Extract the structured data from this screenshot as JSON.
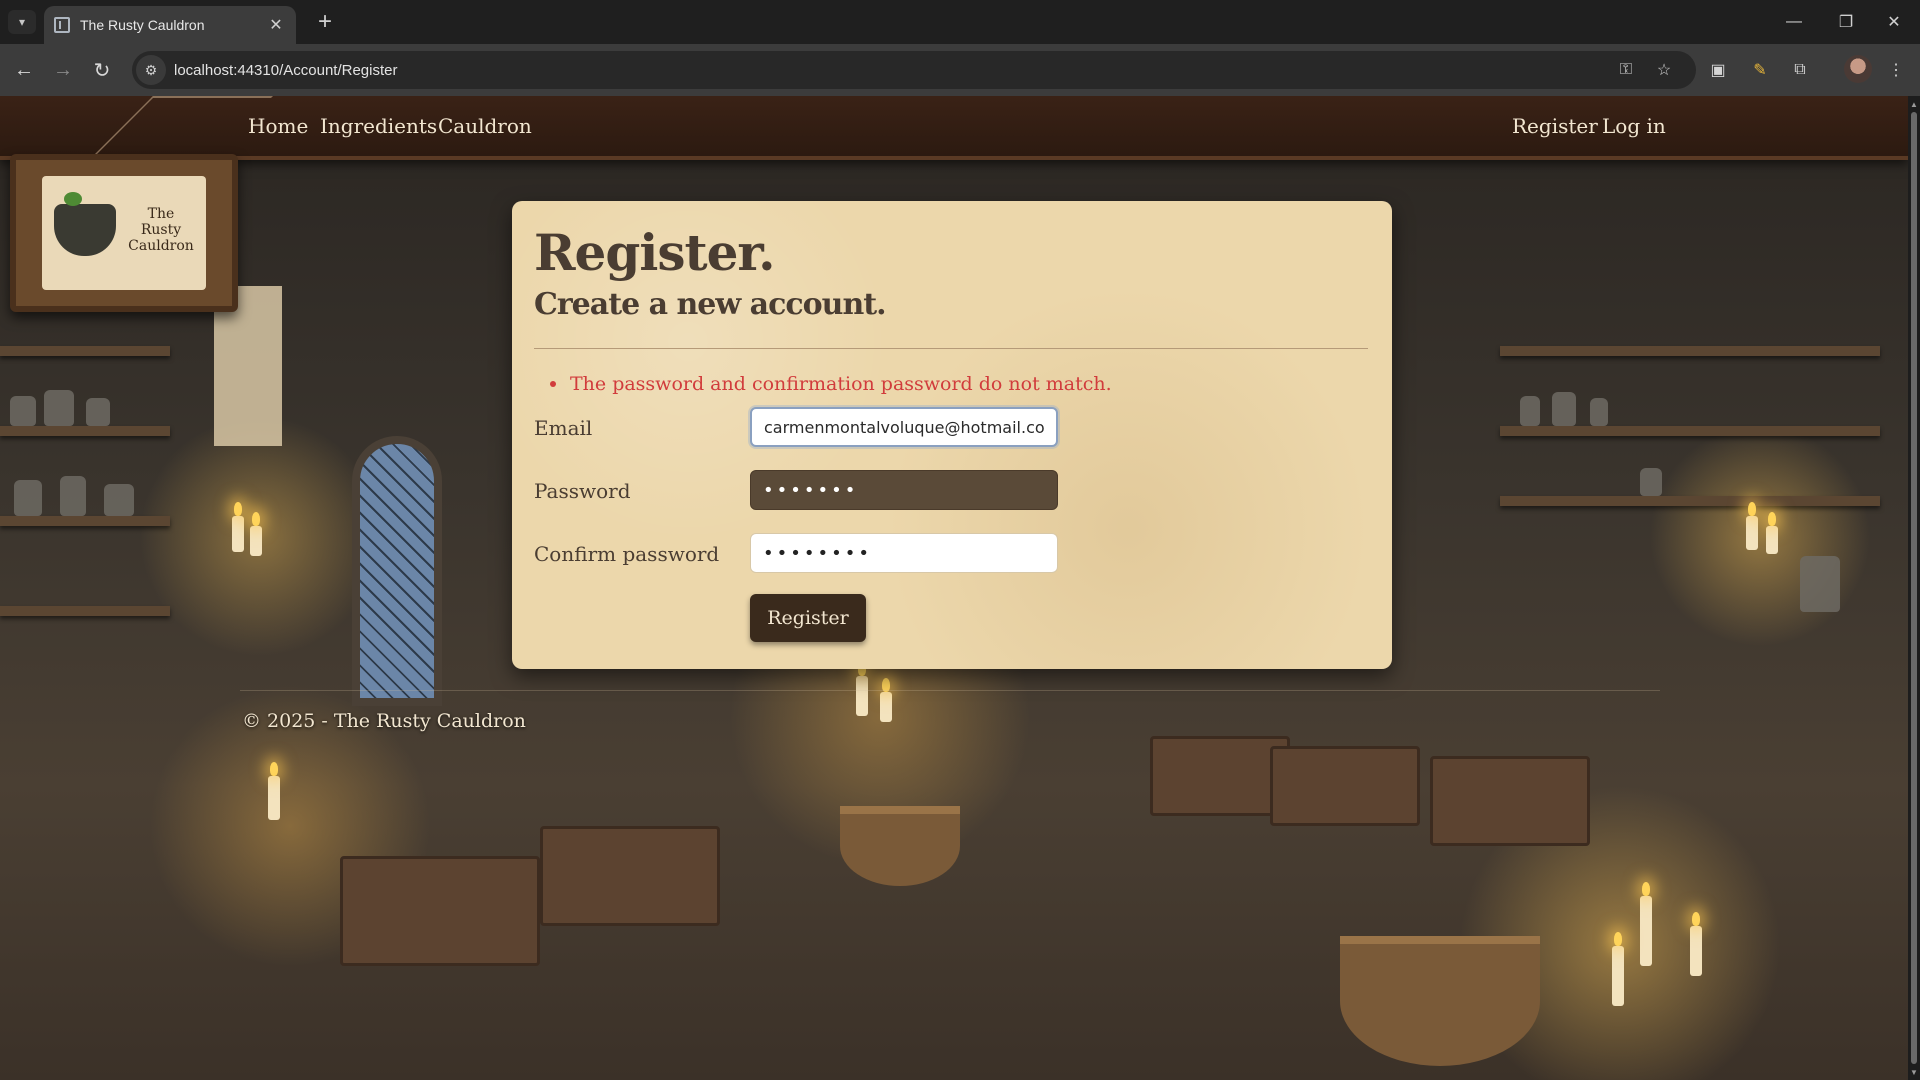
{
  "browser": {
    "tab_title": "The Rusty Cauldron",
    "url": "localhost:44310/Account/Register",
    "icons": {
      "tab_menu": "chevron-down-icon",
      "close": "close-icon",
      "new_tab": "plus-icon",
      "back": "back-arrow-icon",
      "forward": "forward-arrow-icon",
      "reload": "reload-icon",
      "site_info": "tune-icon",
      "password": "key-icon",
      "bookmark": "star-icon",
      "extensions": "puzzle-icon"
    }
  },
  "nav": {
    "left": [
      "Home",
      "Ingredients",
      "Cauldron"
    ],
    "right": [
      "Register",
      "Log in"
    ]
  },
  "logo": {
    "text_line1": "The",
    "text_line2": "Rusty",
    "text_line3": "Cauldron"
  },
  "form": {
    "title": "Register.",
    "subtitle": "Create a new account.",
    "error": "The password and confirmation password do not match.",
    "email_label": "Email",
    "email_value": "carmenmontalvoluque@hotmail.co",
    "password_label": "Password",
    "password_value": "•••••••",
    "confirm_label": "Confirm password",
    "confirm_value": "••••••••",
    "submit": "Register"
  },
  "footer": {
    "text": "© 2025 - The Rusty Cauldron"
  },
  "colors": {
    "error": "#d13c3c",
    "button": "#3a2a1c",
    "card": "#ecd7ab",
    "nav": "#2c1a10"
  }
}
